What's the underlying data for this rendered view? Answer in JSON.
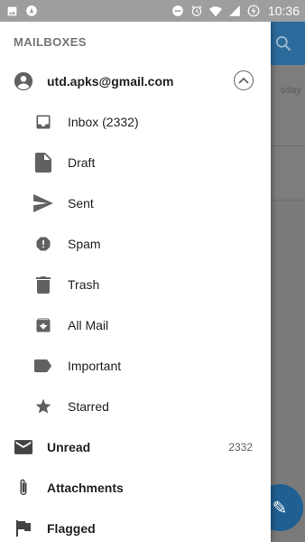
{
  "status_bar": {
    "time": "10:36",
    "icons_left": [
      "image-icon",
      "navigation-icon"
    ],
    "icons_right": [
      "do-not-disturb-icon",
      "alarm-icon",
      "wifi-icon",
      "signal-icon",
      "battery-charging-icon"
    ]
  },
  "background": {
    "date_text": "sday"
  },
  "drawer": {
    "header": "MAILBOXES",
    "account": {
      "email": "utd.apks@gmail.com",
      "icon": "account-circle-icon",
      "toggle_icon": "chevron-up-icon"
    },
    "folders": [
      {
        "label": "Inbox (2332)",
        "icon": "inbox-icon"
      },
      {
        "label": "Draft",
        "icon": "draft-icon"
      },
      {
        "label": "Sent",
        "icon": "send-icon"
      },
      {
        "label": "Spam",
        "icon": "spam-icon"
      },
      {
        "label": "Trash",
        "icon": "trash-icon"
      },
      {
        "label": "All Mail",
        "icon": "archive-icon"
      },
      {
        "label": "Important",
        "icon": "label-icon"
      },
      {
        "label": "Starred",
        "icon": "star-icon"
      }
    ],
    "filters": [
      {
        "label": "Unread",
        "icon": "mail-icon",
        "count": "2332"
      },
      {
        "label": "Attachments",
        "icon": "paperclip-icon",
        "count": ""
      },
      {
        "label": "Flagged",
        "icon": "flag-icon",
        "count": ""
      }
    ]
  },
  "colors": {
    "toolbar": "#2b6c9c",
    "icon_grey": "#616161",
    "text": "#212121",
    "header_text": "#757575"
  }
}
